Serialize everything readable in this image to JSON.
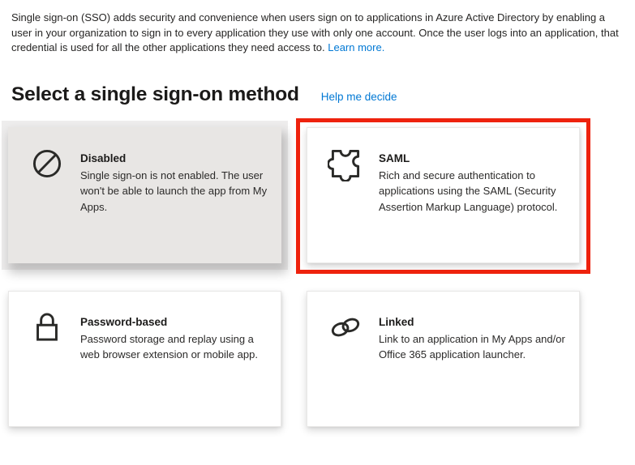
{
  "page": {
    "intro_text": "Single sign-on (SSO) adds security and convenience when users sign on to applications in Azure Active Directory by enabling a user in your organization to sign in to every application they use with only one account. Once the user logs into an application, that credential is used for all the other applications they need access to. ",
    "learn_more_label": "Learn more.",
    "heading": "Select a single sign-on method",
    "help_link_label": "Help me decide"
  },
  "colors": {
    "link_blue": "#0078d4",
    "highlight_red": "#ee220d",
    "selected_card_bg": "#e8e6e4",
    "card_bg": "#ffffff",
    "title_text": "#1c1b1a",
    "body_text": "#2b2a29",
    "icon_stroke": "#2a2a28"
  },
  "cards": [
    {
      "id": "disabled",
      "icon": "prohibition-icon",
      "title": "Disabled",
      "description": "Single sign-on is not enabled. The user won't be able to launch the app from My Apps.",
      "selected": true,
      "highlighted": false
    },
    {
      "id": "saml",
      "icon": "puzzle-icon",
      "title": "SAML",
      "description": "Rich and secure authentication to applications using the SAML (Security Assertion Markup Language) protocol.",
      "selected": false,
      "highlighted": true
    },
    {
      "id": "password-based",
      "icon": "lock-icon",
      "title": "Password-based",
      "description": "Password storage and replay using a web browser extension or mobile app.",
      "selected": false,
      "highlighted": false
    },
    {
      "id": "linked",
      "icon": "link-icon",
      "title": "Linked",
      "description": "Link to an application in My Apps and/or Office 365 application launcher.",
      "selected": false,
      "highlighted": false
    }
  ]
}
